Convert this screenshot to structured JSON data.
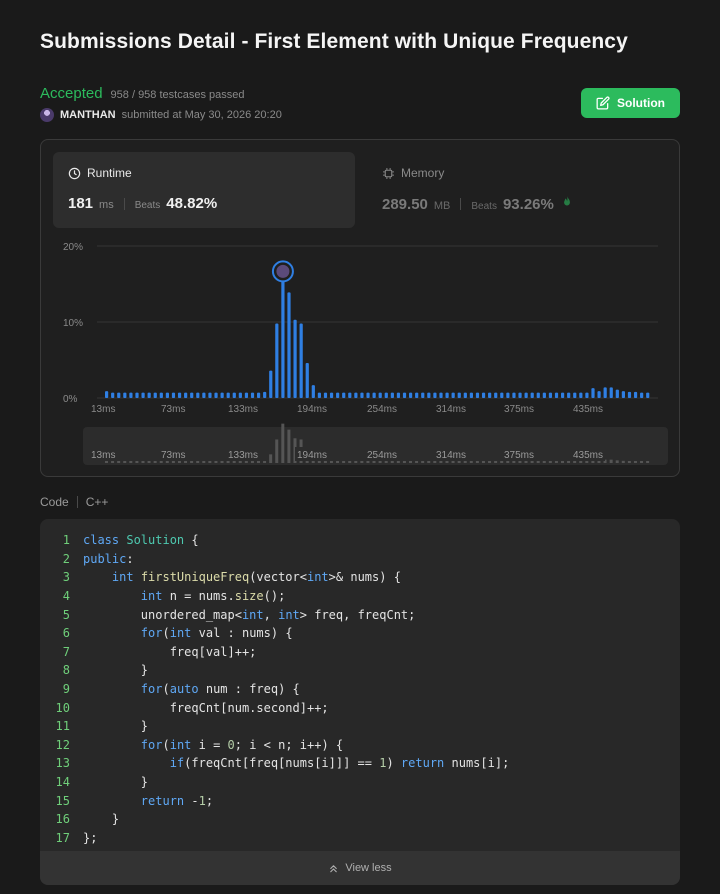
{
  "page": {
    "title": "Submissions Detail - First Element with Unique Frequency"
  },
  "status": {
    "label": "Accepted",
    "testcases": "958 / 958 testcases passed",
    "username": "MANTHAN",
    "submitted_text": "submitted at May 30, 2026 20:20"
  },
  "solution_button": {
    "label": "Solution",
    "icon": "edit-icon"
  },
  "runtime": {
    "label": "Runtime",
    "icon": "clock-icon",
    "value": "181",
    "unit": "ms",
    "beats_label": "Beats",
    "beats_value": "48.82%"
  },
  "memory": {
    "label": "Memory",
    "icon": "chip-icon",
    "value": "289.50",
    "unit": "MB",
    "beats_label": "Beats",
    "beats_value": "93.26%",
    "badge_icon": "fire-icon"
  },
  "chart_data": {
    "type": "bar",
    "y_tick_labels": [
      "20%",
      "10%",
      "0%"
    ],
    "ylim": [
      0,
      20
    ],
    "x_tick_labels": [
      "13ms",
      "73ms",
      "133ms",
      "194ms",
      "254ms",
      "314ms",
      "375ms",
      "435ms"
    ],
    "values": [
      0.9,
      0.7,
      0.7,
      0.7,
      0.7,
      0.7,
      0.7,
      0.7,
      0.7,
      0.7,
      0.7,
      0.7,
      0.7,
      0.7,
      0.7,
      0.7,
      0.7,
      0.7,
      0.7,
      0.7,
      0.7,
      0.7,
      0.7,
      0.7,
      0.7,
      0.7,
      0.8,
      3.6,
      9.8,
      16.4,
      13.9,
      10.3,
      9.8,
      4.6,
      1.7,
      0.7,
      0.7,
      0.7,
      0.7,
      0.7,
      0.7,
      0.7,
      0.7,
      0.7,
      0.7,
      0.7,
      0.7,
      0.7,
      0.7,
      0.7,
      0.7,
      0.7,
      0.7,
      0.7,
      0.7,
      0.7,
      0.7,
      0.7,
      0.7,
      0.7,
      0.7,
      0.7,
      0.7,
      0.7,
      0.7,
      0.7,
      0.7,
      0.7,
      0.7,
      0.7,
      0.7,
      0.7,
      0.7,
      0.7,
      0.7,
      0.7,
      0.7,
      0.7,
      0.7,
      0.7,
      1.3,
      0.9,
      1.4,
      1.4,
      1.1,
      0.9,
      0.8,
      0.8,
      0.7,
      0.7
    ],
    "highlight_index": 29,
    "bar_color": "#2f7fe3",
    "grid": true,
    "minimap_labels": [
      "13ms",
      "73ms",
      "133ms",
      "194ms",
      "254ms",
      "314ms",
      "375ms",
      "435ms"
    ]
  },
  "code": {
    "tab_label": "Code",
    "language": "C++",
    "lines": [
      [
        [
          "kw",
          "class "
        ],
        [
          "cls",
          "Solution"
        ],
        [
          "txt",
          " {"
        ]
      ],
      [
        [
          "kw",
          "public"
        ],
        [
          "txt",
          ":"
        ]
      ],
      [
        [
          "txt",
          "    "
        ],
        [
          "ty",
          "int "
        ],
        [
          "fn",
          "firstUniqueFreq"
        ],
        [
          "txt",
          "(vector<"
        ],
        [
          "ty",
          "int"
        ],
        [
          "txt",
          ">& nums) {"
        ]
      ],
      [
        [
          "txt",
          "        "
        ],
        [
          "ty",
          "int"
        ],
        [
          "txt",
          " n = nums."
        ],
        [
          "fn",
          "size"
        ],
        [
          "txt",
          "();"
        ]
      ],
      [
        [
          "txt",
          "        unordered_map<"
        ],
        [
          "ty",
          "int"
        ],
        [
          "txt",
          ", "
        ],
        [
          "ty",
          "int"
        ],
        [
          "txt",
          "> freq, freqCnt;"
        ]
      ],
      [
        [
          "txt",
          "        "
        ],
        [
          "kw",
          "for"
        ],
        [
          "txt",
          "("
        ],
        [
          "ty",
          "int"
        ],
        [
          "txt",
          " val : nums) {"
        ]
      ],
      [
        [
          "txt",
          "            freq[val]++;"
        ]
      ],
      [
        [
          "txt",
          "        }"
        ]
      ],
      [
        [
          "txt",
          "        "
        ],
        [
          "kw",
          "for"
        ],
        [
          "txt",
          "("
        ],
        [
          "ty",
          "auto"
        ],
        [
          "txt",
          " num : freq) {"
        ]
      ],
      [
        [
          "txt",
          "            freqCnt[num.second]++;"
        ]
      ],
      [
        [
          "txt",
          "        }"
        ]
      ],
      [
        [
          "txt",
          "        "
        ],
        [
          "kw",
          "for"
        ],
        [
          "txt",
          "("
        ],
        [
          "ty",
          "int"
        ],
        [
          "txt",
          " i = "
        ],
        [
          "num",
          "0"
        ],
        [
          "txt",
          "; i < n; i++) {"
        ]
      ],
      [
        [
          "txt",
          "            "
        ],
        [
          "kw",
          "if"
        ],
        [
          "txt",
          "(freqCnt[freq[nums[i]]] == "
        ],
        [
          "num",
          "1"
        ],
        [
          "txt",
          ") "
        ],
        [
          "kw",
          "return"
        ],
        [
          "txt",
          " nums[i];"
        ]
      ],
      [
        [
          "txt",
          "        }"
        ]
      ],
      [
        [
          "txt",
          "        "
        ],
        [
          "kw",
          "return"
        ],
        [
          "txt",
          " -"
        ],
        [
          "num",
          "1"
        ],
        [
          "txt",
          ";"
        ]
      ],
      [
        [
          "txt",
          "    }"
        ]
      ],
      [
        [
          "txt",
          "};"
        ]
      ]
    ],
    "view_less_label": "View less"
  }
}
